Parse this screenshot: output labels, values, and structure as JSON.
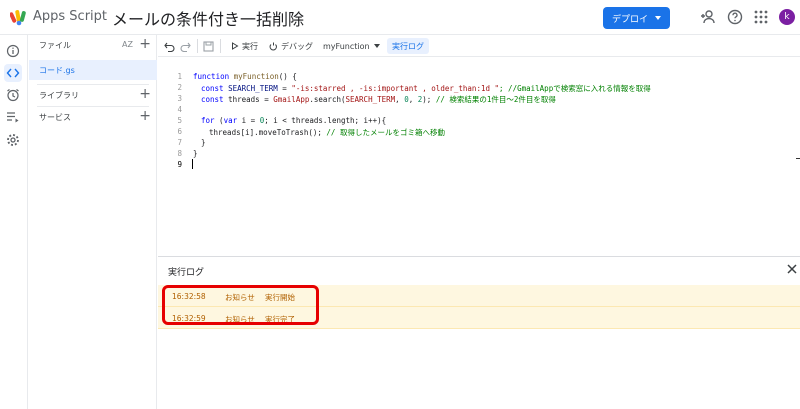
{
  "header": {
    "app_name": "Apps Script",
    "project_title": "メールの条件付き一括削除",
    "deploy_label": "デプロイ",
    "avatar_letter": "k"
  },
  "files_panel": {
    "files_label": "ファイル",
    "sort_label": "AZ",
    "file_name": "コード.gs",
    "libraries_label": "ライブラリ",
    "services_label": "サービス"
  },
  "toolbar": {
    "run_label": "実行",
    "debug_label": "デバッグ",
    "function_name": "myFunction",
    "log_label": "実行ログ"
  },
  "editor": {
    "lines": [
      {
        "n": "1"
      },
      {
        "n": "2"
      },
      {
        "n": "3"
      },
      {
        "n": "4"
      },
      {
        "n": "5"
      },
      {
        "n": "6"
      },
      {
        "n": "7"
      },
      {
        "n": "8"
      },
      {
        "n": "9"
      }
    ],
    "code": {
      "l1_kw": "function",
      "l1_fn": "myFunction",
      "l1_rest": "() {",
      "l2_kw": "const",
      "l2_var": "SEARCH_TERM",
      "l2_eq": " = ",
      "l2_str": "\"-is:starred , -is:important , older_than:1d \"",
      "l2_cm": "; //GmailAppで検索窓に入れる情報を取得",
      "l3_kw": "const",
      "l3_rest": " threads = ",
      "l3_cls": "GmailApp",
      "l3_call": ".search(",
      "l3_var": "SEARCH_TERM",
      "l3_sep1": ", ",
      "l3_n1": "0",
      "l3_sep2": ", ",
      "l3_n2": "2",
      "l3_end": "); ",
      "l3_cm": "// 検索結果の1件目〜2件目を取得",
      "l5_kw": "for",
      "l5_p1": " (",
      "l5_var": "var",
      "l5_p2": " i = ",
      "l5_n": "0",
      "l5_p3": "; i < threads.length; i++){",
      "l6_rest": "threads[i].moveToTrash(); ",
      "l6_cm": "// 取得したメールをゴミ箱へ移動",
      "l7": "}",
      "l8": "}"
    }
  },
  "log_panel": {
    "title": "実行ログ",
    "entries": [
      {
        "time": "16:32:58",
        "level": "お知らせ",
        "message": "実行開始"
      },
      {
        "time": "16:32:59",
        "level": "お知らせ",
        "message": "実行完了"
      }
    ]
  },
  "colors": {
    "accent": "#1a73e8",
    "highlight_border": "#e60000",
    "log_bg": "#fef7e0"
  }
}
